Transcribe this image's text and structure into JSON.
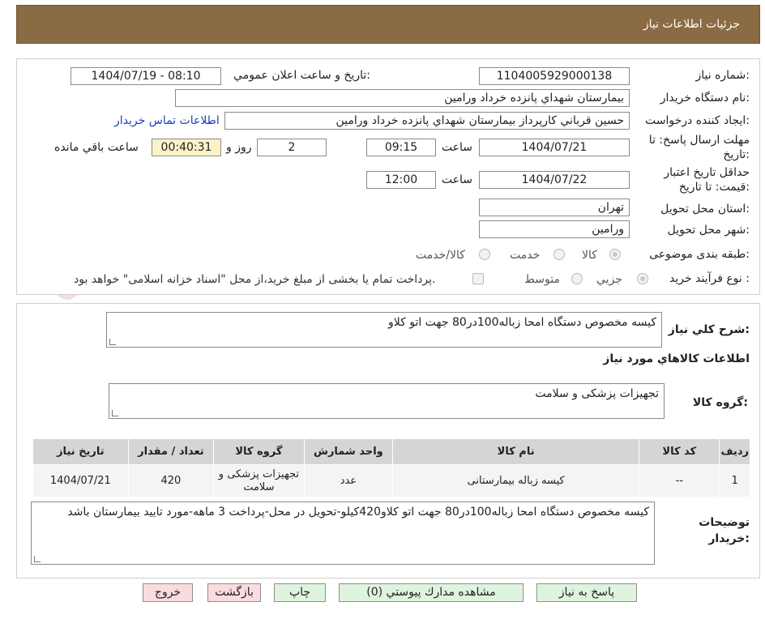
{
  "header": {
    "title": "جزئيات اطلاعات نياز"
  },
  "watermark": {
    "brand": "AriaTender.net",
    "color": "#c0392b"
  },
  "form": {
    "need_number_label": "شماره نياز:",
    "need_number": "1104005929000138",
    "announce_label": "تاريخ و ساعت اعلان عمومي:",
    "announce_value": "1404/07/19 - 08:10",
    "buyer_org_label": "نام دستگاه خريدار:",
    "buyer_org": "بيمارستان شهداي پانزده خرداد ورامين",
    "requester_label": "ايجاد کننده درخواست:",
    "requester": "حسين قرباني کارپرداز بيمارستان شهداي پانزده خرداد ورامين",
    "contact_link": "اطلاعات تماس خريدار",
    "deadline_label_1": "مهلت ارسال پاسخ: تا",
    "deadline_label_2": "تاريخ:",
    "deadline_date": "1404/07/21",
    "time_label": "ساعت",
    "deadline_time": "09:15",
    "days_value": "2",
    "days_label": "روز و",
    "timer_value": "00:40:31",
    "remaining_label": "ساعت باقي مانده",
    "validity_label_1": "حداقل تاريخ اعتبار",
    "validity_label_2": "قيمت: تا تاريخ:",
    "validity_date": "1404/07/22",
    "validity_time": "12:00",
    "province_label": "استان محل تحويل:",
    "province": "تهران",
    "city_label": "شهر محل تحويل:",
    "city": "ورامين",
    "category_label": "طبقه بندی موضوعی:",
    "category_options": [
      "کالا",
      "خدمت",
      "کالا/خدمت"
    ],
    "process_label": "نوع فرآيند خريد :",
    "process_options": [
      "جزيي",
      "متوسط"
    ],
    "payment_note": "پرداخت تمام يا بخشی از مبلغ خريد،از محل \"اسناد خزانه اسلامی\" خواهد بود."
  },
  "description": {
    "label": "شرح كلي نياز:",
    "text": "كيسه مخصوص دستگاه امحا زباله100در80 جهت اتو كلاو"
  },
  "goods": {
    "section_title": "اطلاعات كالاهاي مورد نياز",
    "group_label": "گروه كالا:",
    "group_value": "تجهيزات پزشکی و سلامت",
    "columns": [
      "رديف",
      "كد كالا",
      "نام كالا",
      "واحد شمارش",
      "گروه كالا",
      "تعداد / مقدار",
      "تاريخ نياز"
    ],
    "rows": [
      {
        "row": "1",
        "code": "--",
        "name": "كيسه زباله بيمارستانی",
        "unit": "عدد",
        "group": "تجهيزات پزشکی و سلامت",
        "qty": "420",
        "date": "1404/07/21"
      }
    ]
  },
  "buyer_notes": {
    "label_1": "توضيحات",
    "label_2": "خريدار:",
    "text": "كيسه مخصوص دستگاه امحا زباله100در80 جهت اتو كلاو420كيلو-تحويل در محل-پرداخت 3 ماهه-مورد تاييد بيمارستان باشد"
  },
  "buttons": {
    "reply": "پاسخ به نياز",
    "attachments": "مشاهده مدارك پيوستي (0)",
    "print": "چاپ",
    "back": "بازگشت",
    "exit": "خروج"
  }
}
